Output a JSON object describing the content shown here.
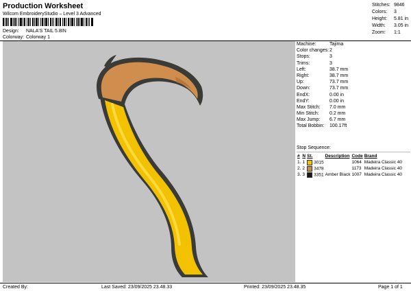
{
  "header": {
    "title": "Production Worksheet",
    "subtitle": "Wilcom EmbroideryStudio – Level 3 Advanced",
    "design_label": "Design:",
    "design_value": "NALA'S TAIL 5.8IN",
    "colorway_label": "Colorway:",
    "colorway_value": "Colorway 1"
  },
  "stats": [
    {
      "label": "Stitches:",
      "value": "9846"
    },
    {
      "label": "Colors:",
      "value": "3"
    },
    {
      "label": "Height:",
      "value": "5.81 in"
    },
    {
      "label": "Width:",
      "value": "3.05 in"
    },
    {
      "label": "Zoom:",
      "value": "1:1"
    }
  ],
  "details": [
    {
      "label": "Machine:",
      "value": "Tajima"
    },
    {
      "label": "Color changes:",
      "value": "2"
    },
    {
      "label": "Stops:",
      "value": "3"
    },
    {
      "label": "Trims:",
      "value": "3"
    },
    {
      "label": "Left:",
      "value": "38.7 mm"
    },
    {
      "label": "Right:",
      "value": "38.7 mm"
    },
    {
      "label": "Up:",
      "value": "73.7 mm"
    },
    {
      "label": "Down:",
      "value": "73.7 mm"
    },
    {
      "label": "EndX:",
      "value": "0.00 in"
    },
    {
      "label": "EndY:",
      "value": "0.00 in"
    },
    {
      "label": "Max Stitch:",
      "value": "7.0 mm"
    },
    {
      "label": "Min Stitch:",
      "value": "0.2 mm"
    },
    {
      "label": "Max Jump:",
      "value": "6.7 mm"
    },
    {
      "label": "Total Bobbin:",
      "value": "100.17ft"
    }
  ],
  "sequence": {
    "heading": "Stop Sequence:",
    "columns": [
      "#",
      "N",
      "St.",
      "Description",
      "Code",
      "Brand"
    ],
    "rows": [
      {
        "num": "1.",
        "n": "1",
        "st": "3015",
        "description": "",
        "code": "1064",
        "brand": "Madeira Classic 40",
        "color": "#f2c200"
      },
      {
        "num": "2.",
        "n": "2",
        "st": "3478",
        "description": "",
        "code": "1173",
        "brand": "Madeira Classic 40",
        "color": "#c98a4a"
      },
      {
        "num": "3.",
        "n": "3",
        "st": "3351",
        "description": "Amber Black",
        "code": "1007",
        "brand": "Madeira Classic 40",
        "color": "#1a1a1a"
      }
    ]
  },
  "footer": {
    "created_by": "Created By:",
    "last_saved": "Last Saved: 23/09/2025 23.48.33",
    "printed": "Printed: 23/09/2025 23.48.35",
    "page": "Page 1 of 1"
  },
  "colors": {
    "canvas_bg": "#c3c3c3",
    "tail_yellow": "#f2c200",
    "tail_tan": "#d08e4e",
    "outline": "#3a3a36"
  }
}
